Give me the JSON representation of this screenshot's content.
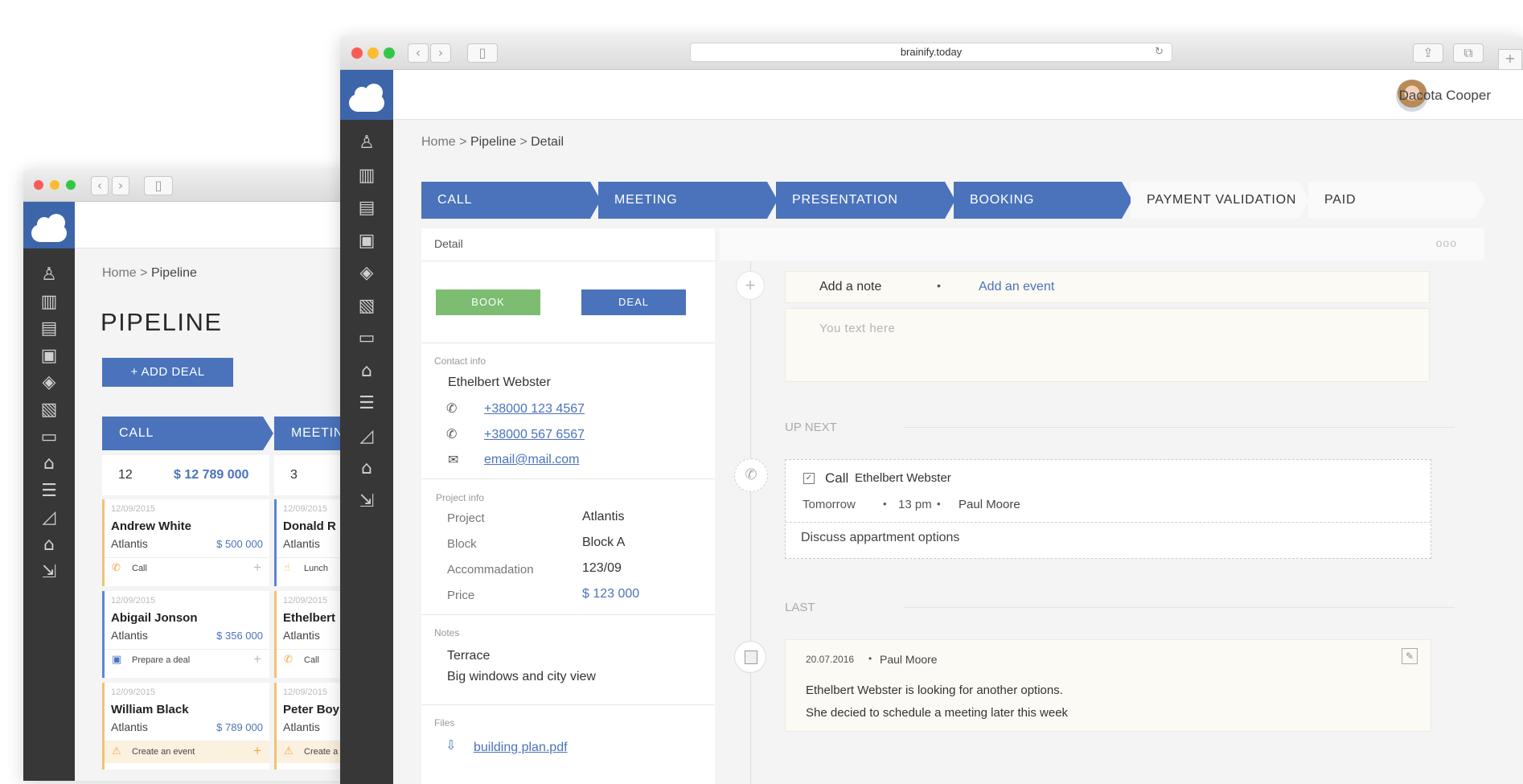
{
  "back_window": {
    "breadcrumb": {
      "home": "Home",
      "sep": ">",
      "current": "Pipeline"
    },
    "title": "PIPELINE",
    "add_deal": "+ ADD DEAL",
    "columns": [
      {
        "stage": "CALL",
        "count": "12",
        "total": "$ 12 789 000",
        "cards": [
          {
            "date": "12/09/2015",
            "name": "Andrew  White",
            "project": "Atlantis",
            "price": "$ 500 000",
            "action": "Call",
            "icon": "phone-icon",
            "plus": "+"
          },
          {
            "date": "12/09/2015",
            "name": "Abigail Jonson",
            "project": "Atlantis",
            "price": "$ 356 000",
            "action": "Prepare a deal",
            "icon": "document-icon",
            "plus": "+"
          },
          {
            "date": "12/09/2015",
            "name": "William Black",
            "project": "Atlantis",
            "price": "$ 789 000",
            "action": "Create an event",
            "icon": "warning-icon",
            "plus": "+"
          }
        ]
      },
      {
        "stage": "MEETIN",
        "count": "3",
        "total": "",
        "cards": [
          {
            "date": "12/09/2015",
            "name": "Donald R",
            "project": "Atlantis",
            "action": "Lunch",
            "icon": "hand-icon"
          },
          {
            "date": "12/09/2015",
            "name": "Ethelbert",
            "project": "Atlantis",
            "action": "Call",
            "icon": "phone-icon"
          },
          {
            "date": "12/09/2015",
            "name": "Peter Boy",
            "project": "Atlantis",
            "action": "Create a",
            "icon": "warning-icon"
          }
        ]
      }
    ]
  },
  "browser": {
    "url": "brainify.today",
    "reload_icon": "reload-icon"
  },
  "user": {
    "name": "Dacota Cooper"
  },
  "breadcrumb": {
    "home": "Home",
    "sep": ">",
    "mid": "Pipeline",
    "current": "Detail"
  },
  "stages": [
    {
      "label": "CALL",
      "active": true
    },
    {
      "label": "MEETING",
      "active": true
    },
    {
      "label": "PRESENTATION",
      "active": true
    },
    {
      "label": "BOOKING",
      "active": true
    },
    {
      "label": "PAYMENT VALIDATION",
      "active": false
    },
    {
      "label": "PAID",
      "active": false
    }
  ],
  "detail": {
    "title": "Detail",
    "book_button": "BOOK",
    "deal_button": "DEAL",
    "contact": {
      "heading": "Contact info",
      "name": "Ethelbert Webster",
      "phone1": "+38000 123 4567",
      "phone2": "+38000 567 6567",
      "email": "email@mail.com"
    },
    "project": {
      "heading": "Project info",
      "rows": [
        {
          "label": "Project",
          "value": "Atlantis"
        },
        {
          "label": "Block",
          "value": "Block A"
        },
        {
          "label": "Accommadation",
          "value": "123/09"
        },
        {
          "label": "Price",
          "value": "$ 123 000"
        }
      ]
    },
    "notes": {
      "heading": "Notes",
      "line1": "Terrace",
      "line2": "Big windows and city view"
    },
    "files": {
      "heading": "Files",
      "file": "building plan.pdf"
    }
  },
  "activity": {
    "more": "ooo",
    "add_note": "Add a note",
    "dot": "•",
    "add_event": "Add an event",
    "placeholder": "You text here",
    "up_next": "UP NEXT",
    "task": {
      "verb": "Call",
      "who": "Ethelbert Webster",
      "when": "Tomorrow",
      "time": "13 pm",
      "person": "Paul Moore",
      "desc": "Discuss appartment options"
    },
    "last": "LAST",
    "note": {
      "date": "20.07.2016",
      "author": "Paul Moore",
      "line1": "Ethelbert Webster is looking for another options.",
      "line2": "She decied to schedule a meeting later this week"
    }
  },
  "colors": {
    "accent": "#4a73bb",
    "sidebar": "#373737",
    "book": "#7cbd72"
  }
}
